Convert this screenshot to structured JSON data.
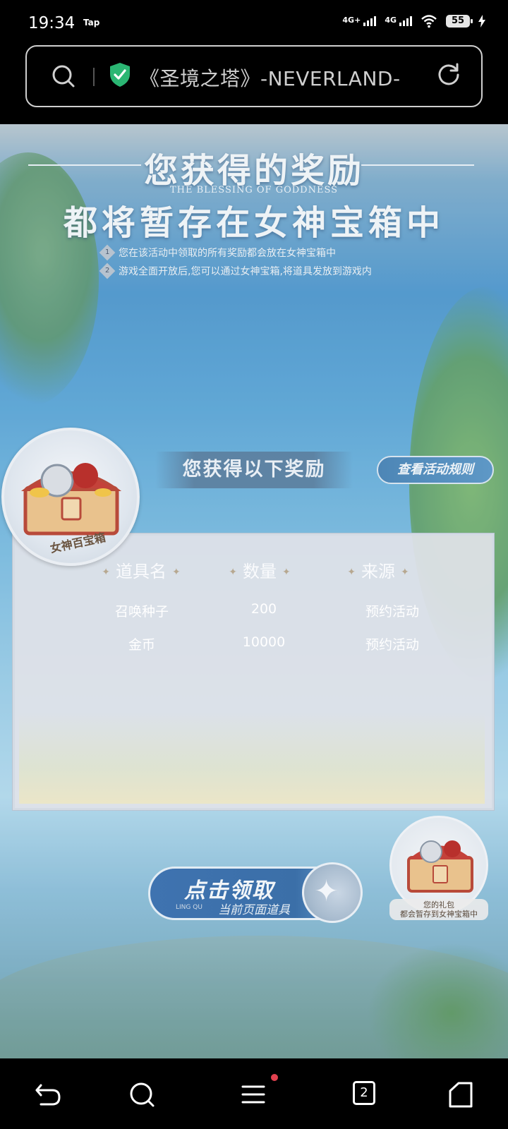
{
  "status_bar": {
    "time": "19:34",
    "app_badge": "Tap",
    "signal1_label": "4G+",
    "signal2_label": "4G",
    "battery": "55"
  },
  "address_bar": {
    "url_text": "《圣境之塔》-NEVERLAND-"
  },
  "banner": {
    "title_line1": "您获得的奖励",
    "subtitle_en": "THE BLESSING OF GODDNESS",
    "title_line2": "都将暂存在女神宝箱中",
    "notes": [
      {
        "num": "1",
        "text": "您在该活动中领取的所有奖励都会放在女神宝箱中"
      },
      {
        "num": "2",
        "text": "游戏全面开放后,您可以通过女神宝箱,将道具发放到游戏内"
      }
    ]
  },
  "rewards": {
    "heading": "您获得以下奖励",
    "rules_button": "查看活动规则",
    "chest_label": "女神百宝箱",
    "columns": [
      "道具名",
      "数量",
      "来源"
    ],
    "rows": [
      {
        "name": "召唤种子",
        "qty": "200",
        "source": "预约活动"
      },
      {
        "name": "金币",
        "qty": "10000",
        "source": "预约活动"
      }
    ]
  },
  "claim": {
    "main": "点击领取",
    "sub": "当前页面道具",
    "small": "LING QU"
  },
  "gift_badge": {
    "caption_line1": "您的礼包",
    "caption_line2": "都会暂存到女神宝箱中"
  },
  "bottom_nav": {
    "tab_count": "2"
  },
  "colors": {
    "accent_blue": "#3f73b0",
    "notification_dot": "#e2414f",
    "shield_green": "#2bb673"
  }
}
